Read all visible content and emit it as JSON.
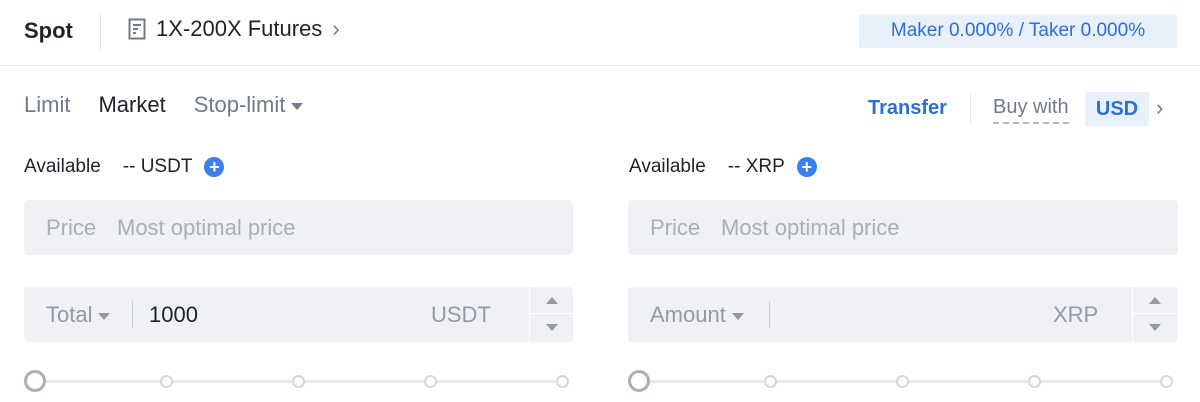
{
  "header": {
    "spot_label": "Spot",
    "futures_label": "1X-200X Futures",
    "fee_text": "Maker 0.000% / Taker 0.000%"
  },
  "tabs": [
    {
      "label": "Limit",
      "active": false
    },
    {
      "label": "Market",
      "active": true
    },
    {
      "label": "Stop-limit",
      "active": false
    }
  ],
  "toolbar": {
    "transfer_label": "Transfer",
    "buy_with_label": "Buy with",
    "currency": "USD"
  },
  "buy": {
    "available_label": "Available",
    "available_value": "-- USDT",
    "price_label": "Price",
    "price_placeholder": "Most optimal price",
    "total_label": "Total",
    "total_value": "1000",
    "total_unit": "USDT",
    "slider_percent": 0
  },
  "sell": {
    "available_label": "Available",
    "available_value": "-- XRP",
    "price_label": "Price",
    "price_placeholder": "Most optimal price",
    "amount_label": "Amount",
    "amount_value": "",
    "amount_unit": "XRP",
    "slider_percent": 0
  },
  "colors": {
    "accent": "#2b6fd6",
    "accent_bg": "#e8f0fc",
    "field_bg": "#eff1f4"
  },
  "icons": {
    "futures": "document-icon",
    "chevron": "chevron-right-icon",
    "add": "plus-circle-icon"
  }
}
